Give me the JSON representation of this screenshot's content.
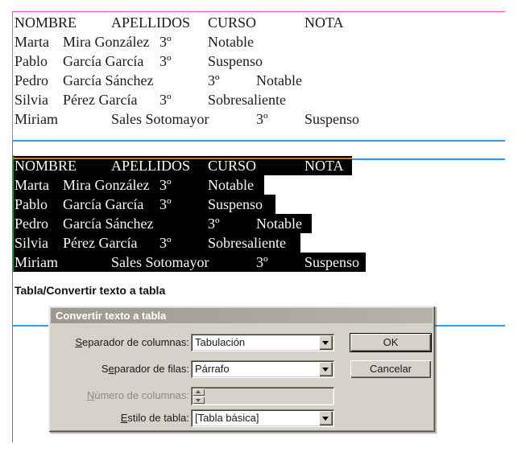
{
  "table_text": {
    "rows": [
      {
        "c0": "NOMBRE",
        "c1": "APELLIDOS",
        "c2": "CURSO",
        "c3": "NOTA"
      },
      {
        "c0": "Marta",
        "c1": "Mira González",
        "c2": "3º",
        "c3": "Notable"
      },
      {
        "c0": "Pablo",
        "c1": "García García",
        "c2": "3º",
        "c3": "Suspenso"
      },
      {
        "c0": "Pedro",
        "c1": "García Sánchez",
        "c2": "3º",
        "c3": "Notable"
      },
      {
        "c0": "Silvia",
        "c1": "Pérez García",
        "c2": "3º",
        "c3": "Sobresaliente"
      },
      {
        "c0": "Miriam",
        "c1": "Sales Sotomayor",
        "c2": "3º",
        "c3": "Suspenso"
      }
    ]
  },
  "menu_path_label": "Tabla/Convertir texto a tabla",
  "dialog": {
    "title": "Convertir texto a tabla",
    "fields": {
      "col_sep": {
        "pre": "",
        "acc": "S",
        "post": "eparador de columnas:",
        "value": "Tabulación"
      },
      "row_sep": {
        "pre": "S",
        "acc": "e",
        "post": "parador de filas:",
        "value": "Párrafo"
      },
      "num_cols": {
        "pre": "",
        "acc": "N",
        "post": "úmero de columnas:",
        "value": ""
      },
      "style": {
        "pre": "",
        "acc": "E",
        "post": "stilo de tabla:",
        "value": "[Tabla básica]"
      }
    },
    "buttons": {
      "ok": "OK",
      "cancel": "Cancelar"
    }
  },
  "colors": {
    "frame_edge_pink": "#ff4fc6",
    "guide_blue": "#2e9cf5",
    "margin_purple": "#a052e0",
    "selected_frame_green": "#0b9f42",
    "selected_frame_orange": "#d2721c",
    "selection_highlight": "#000000",
    "dialog_face": "#d6d2ca",
    "titlebar_gray_left": "#9d998f",
    "titlebar_gray_right": "#b7b3ab"
  }
}
